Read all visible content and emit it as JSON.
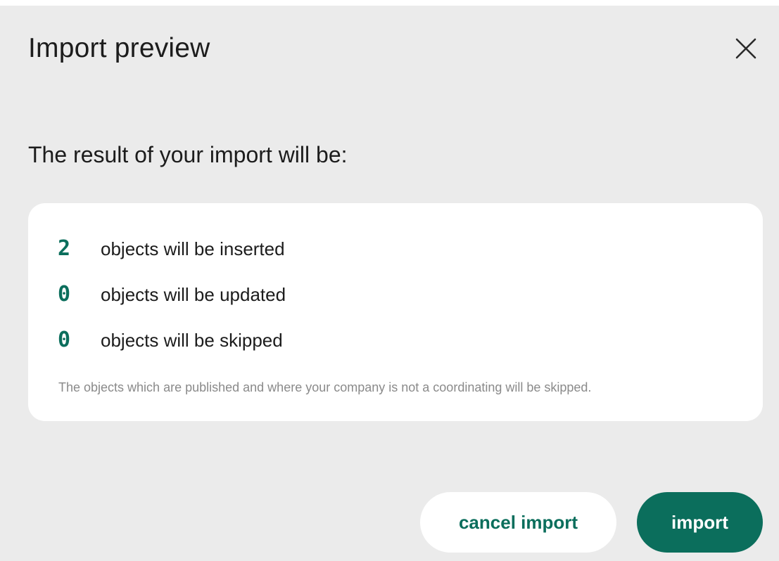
{
  "dialog": {
    "title": "Import preview",
    "close_icon": "close-icon"
  },
  "summary": {
    "heading": "The result of your import will be:",
    "rows": [
      {
        "count": "2",
        "label": "objects will be inserted"
      },
      {
        "count": "0",
        "label": "objects will be updated"
      },
      {
        "count": "0",
        "label": "objects will be skipped"
      }
    ],
    "note": "The objects which are published and where your company is not a coordinating will be skipped."
  },
  "actions": {
    "cancel_label": "cancel import",
    "import_label": "import"
  },
  "colors": {
    "accent": "#0b6e5c",
    "dialog_bg": "#ebebeb",
    "card_bg": "#ffffff",
    "note_text": "#8a8a8a"
  }
}
